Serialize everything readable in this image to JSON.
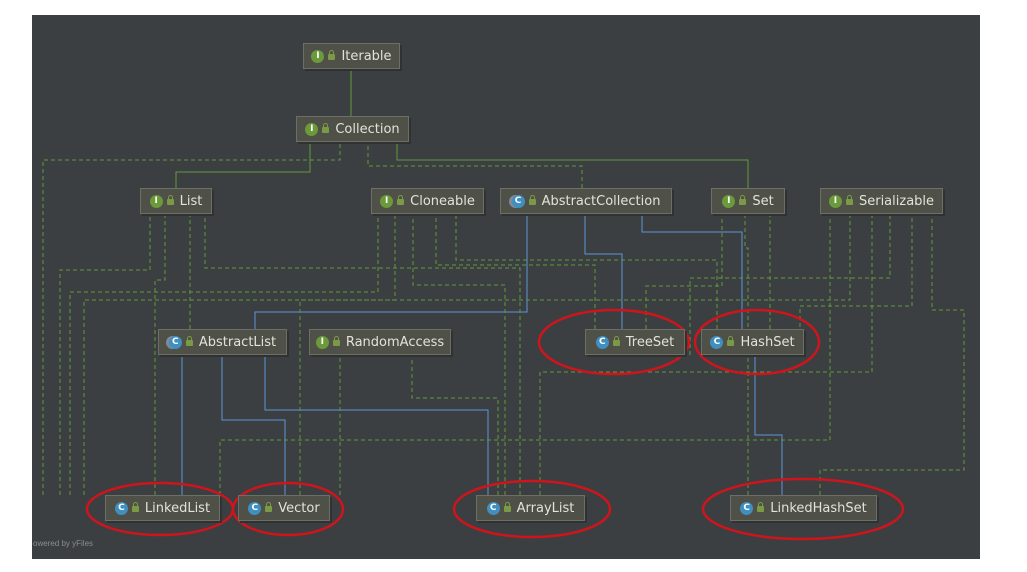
{
  "diagram": {
    "nodes": {
      "iterable": {
        "label": "Iterable",
        "kind": "interface",
        "kind_letter": "I"
      },
      "collection": {
        "label": "Collection",
        "kind": "interface",
        "kind_letter": "I"
      },
      "list": {
        "label": "List",
        "kind": "interface",
        "kind_letter": "I"
      },
      "cloneable": {
        "label": "Cloneable",
        "kind": "interface",
        "kind_letter": "I"
      },
      "abstract_collection": {
        "label": "AbstractCollection",
        "kind": "abstract",
        "kind_letter": "C"
      },
      "set": {
        "label": "Set",
        "kind": "interface",
        "kind_letter": "I"
      },
      "serializable": {
        "label": "Serializable",
        "kind": "interface",
        "kind_letter": "I"
      },
      "abstract_list": {
        "label": "AbstractList",
        "kind": "abstract",
        "kind_letter": "C"
      },
      "random_access": {
        "label": "RandomAccess",
        "kind": "interface",
        "kind_letter": "I"
      },
      "tree_set": {
        "label": "TreeSet",
        "kind": "class",
        "kind_letter": "C"
      },
      "hash_set": {
        "label": "HashSet",
        "kind": "class",
        "kind_letter": "C"
      },
      "linked_list": {
        "label": "LinkedList",
        "kind": "class",
        "kind_letter": "C"
      },
      "vector": {
        "label": "Vector",
        "kind": "class",
        "kind_letter": "C"
      },
      "array_list": {
        "label": "ArrayList",
        "kind": "class",
        "kind_letter": "C"
      },
      "linked_hash_set": {
        "label": "LinkedHashSet",
        "kind": "class",
        "kind_letter": "C"
      }
    },
    "highlighted": [
      "tree_set",
      "hash_set",
      "linked_list",
      "vector",
      "array_list",
      "linked_hash_set"
    ],
    "colors": {
      "background": "#3c3f41",
      "implements_edge": "#62983a",
      "extends_edge": "#5a95d6",
      "highlight_ellipse": "#d0141c"
    },
    "footer": "owered by yFiles"
  }
}
